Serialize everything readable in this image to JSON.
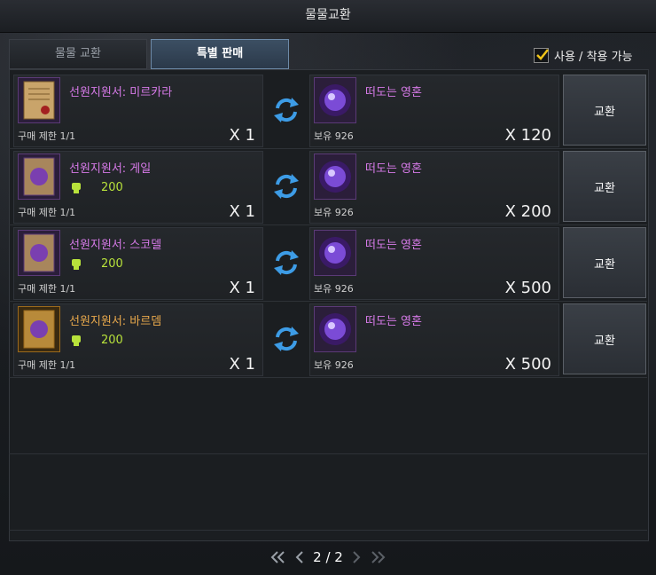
{
  "window": {
    "title": "물물교환"
  },
  "tabs": [
    {
      "label": "물물 교환",
      "active": false
    },
    {
      "label": "특별 판매",
      "active": true
    }
  ],
  "filter": {
    "label": "사용 / 착용 가능",
    "checked": true
  },
  "trades": [
    {
      "give": {
        "name": "선원지원서: 미르카라",
        "rarity": "purple",
        "bonus": "",
        "limit": "구매 제한 1/1",
        "qty": "X 1"
      },
      "get": {
        "name": "떠도는 영혼",
        "owned": "보유 926",
        "qty": "X 120"
      },
      "button": "교환"
    },
    {
      "give": {
        "name": "선원지원서: 게일",
        "rarity": "purple",
        "bonus": "200",
        "limit": "구매 제한 1/1",
        "qty": "X 1"
      },
      "get": {
        "name": "떠도는 영혼",
        "owned": "보유 926",
        "qty": "X 200"
      },
      "button": "교환"
    },
    {
      "give": {
        "name": "선원지원서: 스코델",
        "rarity": "purple",
        "bonus": "200",
        "limit": "구매 제한 1/1",
        "qty": "X 1"
      },
      "get": {
        "name": "떠도는 영혼",
        "owned": "보유 926",
        "qty": "X 500"
      },
      "button": "교환"
    },
    {
      "give": {
        "name": "선원지원서: 바르뎀",
        "rarity": "gold",
        "bonus": "200",
        "limit": "구매 제한 1/1",
        "qty": "X 1"
      },
      "get": {
        "name": "떠도는 영혼",
        "owned": "보유 926",
        "qty": "X 500"
      },
      "button": "교환"
    }
  ],
  "pager": {
    "text": "2 / 2"
  },
  "colors": {
    "purple_text": "#d67ae8",
    "gold_text": "#e9a94c",
    "bonus_text": "#b8e23b",
    "swap": "#3d9ce6"
  }
}
